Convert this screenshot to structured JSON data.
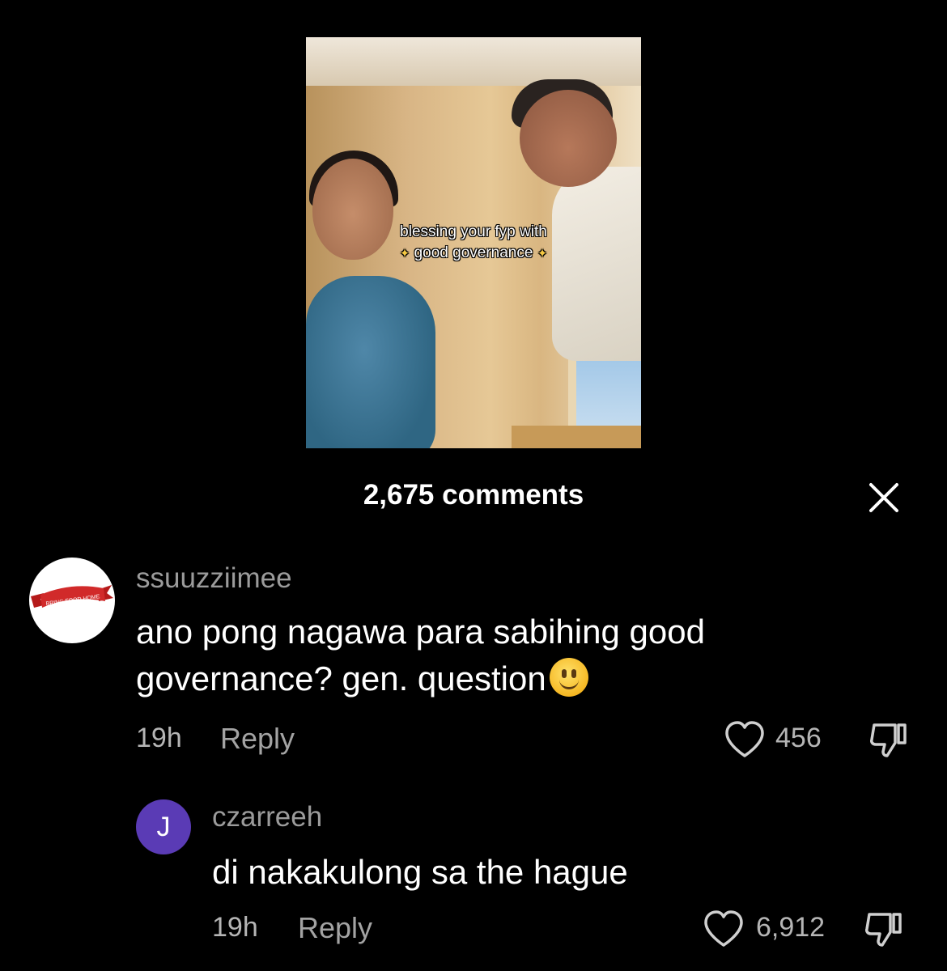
{
  "video": {
    "caption_line1": "blessing your fyp with",
    "caption_line2": "good governance"
  },
  "header": {
    "title": "2,675 comments"
  },
  "comments": [
    {
      "username": "ssuuzziimee",
      "avatar_text": "BRING FOOD HOME",
      "text": "ano pong nagawa para sabihing good governance? gen. question",
      "time": "19h",
      "reply_label": "Reply",
      "likes": "456"
    },
    {
      "username": "czarreeh",
      "avatar_letter": "J",
      "text": "di nakakulong sa the hague",
      "time": "19h",
      "reply_label": "Reply",
      "likes": "6,912"
    }
  ],
  "icons": {
    "close": "close-icon",
    "like": "heart-icon",
    "dislike": "thumbs-down-icon"
  },
  "colors": {
    "background": "#000000",
    "avatar_j": "#5a3bb5",
    "secondary_text": "#9b9b9b"
  }
}
